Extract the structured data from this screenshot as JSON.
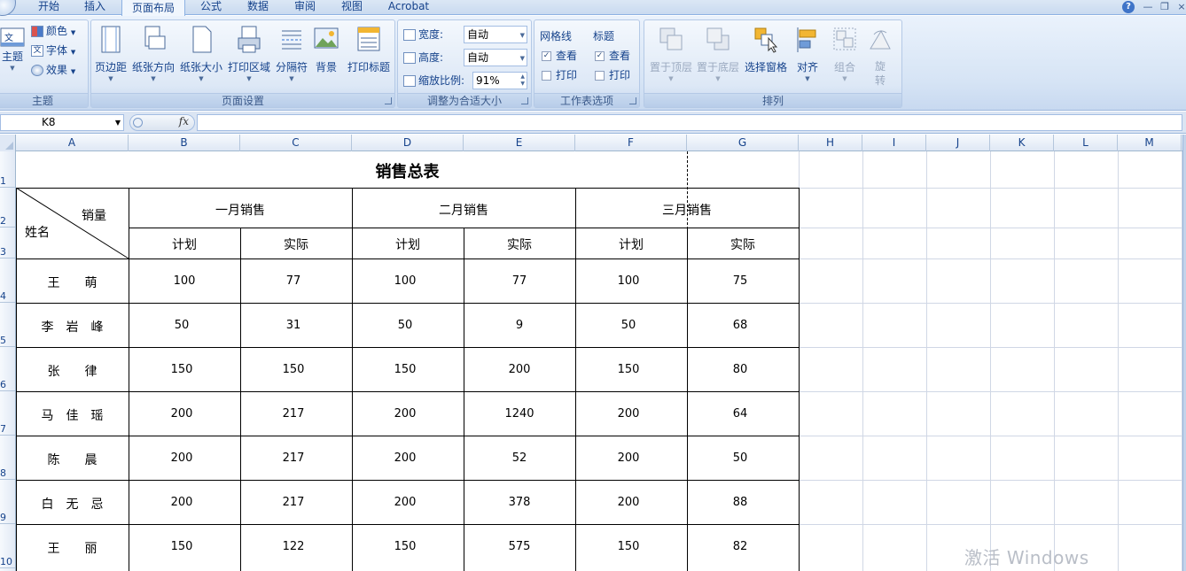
{
  "ribbon_tabs": [
    "开始",
    "插入",
    "页面布局",
    "公式",
    "数据",
    "审阅",
    "视图",
    "Acrobat"
  ],
  "active_tab": "页面布局",
  "theme_group": {
    "label": "主题",
    "themes_button": "主题",
    "colors": "颜色",
    "fonts": "字体",
    "effects": "效果"
  },
  "page_setup_group": {
    "label": "页面设置",
    "buttons": [
      "页边距",
      "纸张方向",
      "纸张大小",
      "打印区域",
      "分隔符",
      "背景",
      "打印标题"
    ]
  },
  "scale_group": {
    "label": "调整为合适大小",
    "width_label": "宽度:",
    "width_value": "自动",
    "height_label": "高度:",
    "height_value": "自动",
    "scale_label": "缩放比例:",
    "scale_value": "91%"
  },
  "sheet_options_group": {
    "label": "工作表选项",
    "gridlines_title": "网格线",
    "headings_title": "标题",
    "view_label": "查看",
    "print_label": "打印",
    "gridlines_view": true,
    "gridlines_print": false,
    "headings_view": true,
    "headings_print": false
  },
  "arrange_group": {
    "label": "排列",
    "buttons": [
      "置于顶层",
      "置于底层",
      "选择窗格",
      "对齐",
      "组合",
      "旋转"
    ]
  },
  "formula_bar": {
    "name_box": "K8",
    "fx": "fx",
    "formula": ""
  },
  "columns": [
    "A",
    "B",
    "C",
    "D",
    "E",
    "F",
    "G",
    "H",
    "I",
    "J",
    "K",
    "L",
    "M"
  ],
  "rows": [
    "1",
    "2",
    "3",
    "4",
    "5",
    "6",
    "7",
    "8",
    "9",
    "10"
  ],
  "table": {
    "title": "销售总表",
    "corner_top": "销量",
    "corner_bottom": "姓名",
    "months": [
      "一月销售",
      "二月销售",
      "三月销售"
    ],
    "sub_headers": [
      "计划",
      "实际",
      "计划",
      "实际",
      "计划",
      "实际"
    ],
    "data": [
      {
        "name": "王　　萌",
        "values": [
          "100",
          "77",
          "100",
          "77",
          "100",
          "75"
        ]
      },
      {
        "name": "李　岩　峰",
        "values": [
          "50",
          "31",
          "50",
          "9",
          "50",
          "68"
        ]
      },
      {
        "name": "张　　律",
        "values": [
          "150",
          "150",
          "150",
          "200",
          "150",
          "80"
        ]
      },
      {
        "name": "马　佳　瑶",
        "values": [
          "200",
          "217",
          "200",
          "1240",
          "200",
          "64"
        ]
      },
      {
        "name": "陈　　晨",
        "values": [
          "200",
          "217",
          "200",
          "52",
          "200",
          "50"
        ]
      },
      {
        "name": "白　无　忌",
        "values": [
          "200",
          "217",
          "200",
          "378",
          "200",
          "88"
        ]
      },
      {
        "name": "王　　丽",
        "values": [
          "150",
          "122",
          "150",
          "575",
          "150",
          "82"
        ]
      }
    ]
  },
  "watermark": "激活 Windows",
  "window_controls": {
    "help": "?",
    "minimize": "—",
    "restore": "❐",
    "close": "×"
  }
}
